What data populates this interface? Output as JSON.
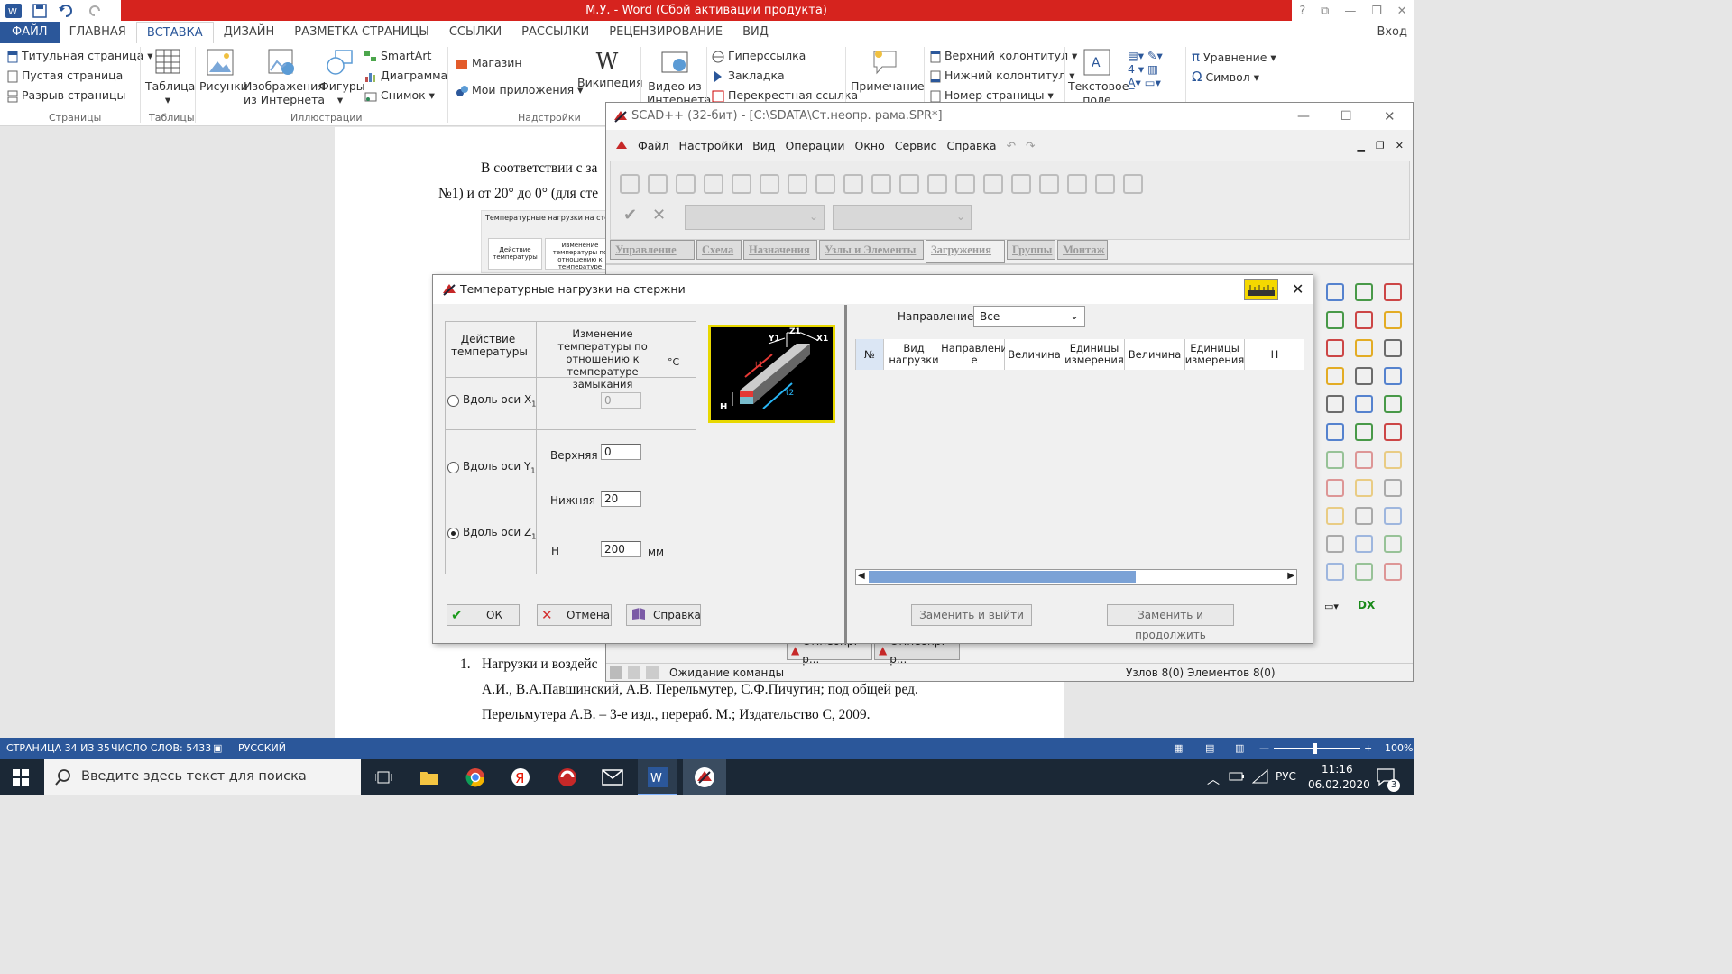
{
  "word": {
    "title": "М.У. -  Word (Сбой активации продукта)",
    "window_controls": [
      "?",
      "⧉",
      "—",
      "❐",
      "✕"
    ],
    "tabs": [
      "ФАЙЛ",
      "ГЛАВНАЯ",
      "ВСТАВКА",
      "ДИЗАЙН",
      "РАЗМЕТКА СТРАНИЦЫ",
      "ССЫЛКИ",
      "РАССЫЛКИ",
      "РЕЦЕНЗИРОВАНИЕ",
      "ВИД"
    ],
    "active_tab": "ВСТАВКА",
    "login": "Вход",
    "ribbon": {
      "pages": [
        "Титульная страница",
        "Пустая страница",
        "Разрыв страницы"
      ],
      "pages_group": "Страницы",
      "table": "Таблица",
      "tables_group": "Таблицы",
      "pictures": "Рисунки",
      "online_pictures_1": "Изображения",
      "online_pictures_2": "из Интернета",
      "shapes": "Фигуры",
      "smartart": "SmartArt",
      "chart": "Диаграмма",
      "screenshot": "Снимок",
      "illustrations_group": "Иллюстрации",
      "store": "Магазин",
      "my_apps": "Мои приложения",
      "wikipedia": "Википедия",
      "addins_group": "Надстройки",
      "video_1": "Видео из",
      "video_2": "Интернета",
      "hyperlink": "Гиперссылка",
      "bookmark": "Закладка",
      "crossref": "Перекрестная ссылка",
      "comment": "Примечание",
      "header": "Верхний колонтитул",
      "footer": "Нижний колонтитул",
      "page_number": "Номер страницы",
      "textbox_1": "Текстовое",
      "textbox_2": "поле",
      "equation": "Уравнение",
      "symbol": "Символ"
    },
    "doc": {
      "line1": "В соответствии с за",
      "line2": "№1) и от 20° до 0° (для сте",
      "list_num": "1.",
      "ref1": "Нагрузки и воздейс",
      "ref2": "А.И., В.А.Павшинский, А.В. Перельмутер, С.Ф.Пичугин; под общей ред.",
      "ref3": "Перельмутера А.В. – 3-е изд., перераб. М.; Издательство С, 2009.",
      "thumb_title": "Температурные нагрузки на стержни",
      "thumb_c1": "Действие температуры",
      "thumb_c2": "Изменение температуры по отношению к температуре замыкания"
    },
    "status": {
      "page": "СТРАНИЦА 34 ИЗ 35",
      "words": "ЧИСЛО СЛОВ: 5433",
      "lang": "РУССКИЙ",
      "zoom": "100%"
    }
  },
  "taskbar": {
    "search_placeholder": "Введите здесь текст для поиска",
    "lang": "РУС",
    "time": "11:16",
    "date": "06.02.2020",
    "notifications": "3"
  },
  "scad": {
    "title": "SCAD++ (32-бит) - [C:\\SDATA\\Ст.неопр. рама.SPR*]",
    "menu": [
      "Файл",
      "Настройки",
      "Вид",
      "Операции",
      "Окно",
      "Сервис",
      "Справка"
    ],
    "tabs": [
      "Управление",
      "Схема",
      "Назначения",
      "Узлы и Элементы",
      "Загружения",
      "Группы",
      "Монтаж"
    ],
    "doc_tabs": [
      "Ст.неопр. р...",
      "Ст.неопр. р..."
    ],
    "status_left": "Ожидание команды",
    "status_right": "Узлов 8(0) Элементов 8(0)",
    "dx_label": "DX"
  },
  "dialog": {
    "title": "Температурные нагрузки на стержни",
    "col_action": "Действие температуры",
    "col_change": "Изменение температуры по отношению к температуре замыкания",
    "unit_c": "°С",
    "along_x": "Вдоль оси X",
    "along_y": "Вдоль оси Y",
    "along_z": "Вдоль оси Z",
    "axis_sub": "1",
    "x_value": "0",
    "upper_label": "Верхняя",
    "upper_value": "0",
    "lower_label": "Нижняя",
    "lower_value": "20",
    "h_label": "Н",
    "h_value": "200",
    "h_unit": "мм",
    "ok": "ОК",
    "cancel": "Отмена",
    "help": "Справка",
    "direction_label": "Направление :",
    "direction_value": "Все",
    "table_headers": [
      "№",
      "Вид нагрузки",
      "Направлени е",
      "Величина",
      "Единицы измерения",
      "Величина",
      "Единицы измерения",
      "Н"
    ],
    "replace_exit": "Заменить и выйти",
    "replace_continue": "Заменить и продолжить",
    "diagram": {
      "y": "Y1",
      "z": "Z1",
      "x": "X1",
      "t1": "t1",
      "t2": "t2",
      "h": "H"
    }
  }
}
